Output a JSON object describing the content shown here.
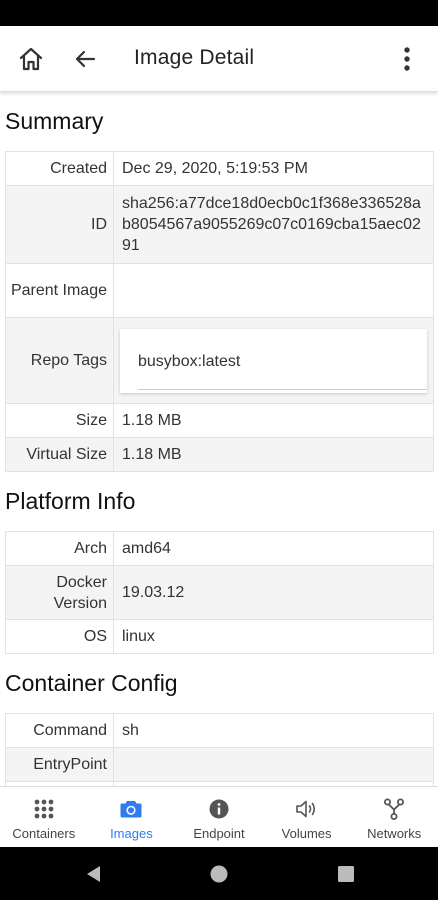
{
  "app_bar": {
    "title": "Image Detail"
  },
  "summary": {
    "title": "Summary",
    "rows": [
      {
        "key": "Created",
        "value": "Dec 29, 2020, 5:19:53 PM"
      },
      {
        "key": "ID",
        "value": "sha256:a77dce18d0ecb0c1f368e336528ab8054567a9055269c07c0169cba15aec0291"
      },
      {
        "key": "Parent Image",
        "value": ""
      },
      {
        "key": "Repo Tags",
        "value": "busybox:latest"
      },
      {
        "key": "Size",
        "value": "1.18 MB"
      },
      {
        "key": "Virtual Size",
        "value": "1.18 MB"
      }
    ]
  },
  "platform": {
    "title": "Platform Info",
    "rows": [
      {
        "key": "Arch",
        "value": "amd64"
      },
      {
        "key": "Docker Version",
        "value": "19.03.12"
      },
      {
        "key": "OS",
        "value": "linux"
      }
    ]
  },
  "container": {
    "title": "Container Config",
    "rows": [
      {
        "key": "Command",
        "value": "sh"
      },
      {
        "key": "EntryPoint",
        "value": ""
      }
    ]
  },
  "bottom_nav": {
    "items": [
      {
        "label": "Containers",
        "icon": "grid-icon"
      },
      {
        "label": "Images",
        "icon": "camera-icon"
      },
      {
        "label": "Endpoint",
        "icon": "info-icon"
      },
      {
        "label": "Volumes",
        "icon": "volume-icon"
      },
      {
        "label": "Networks",
        "icon": "network-icon"
      }
    ],
    "active_index": 1,
    "active_color": "#2f7cf0"
  }
}
